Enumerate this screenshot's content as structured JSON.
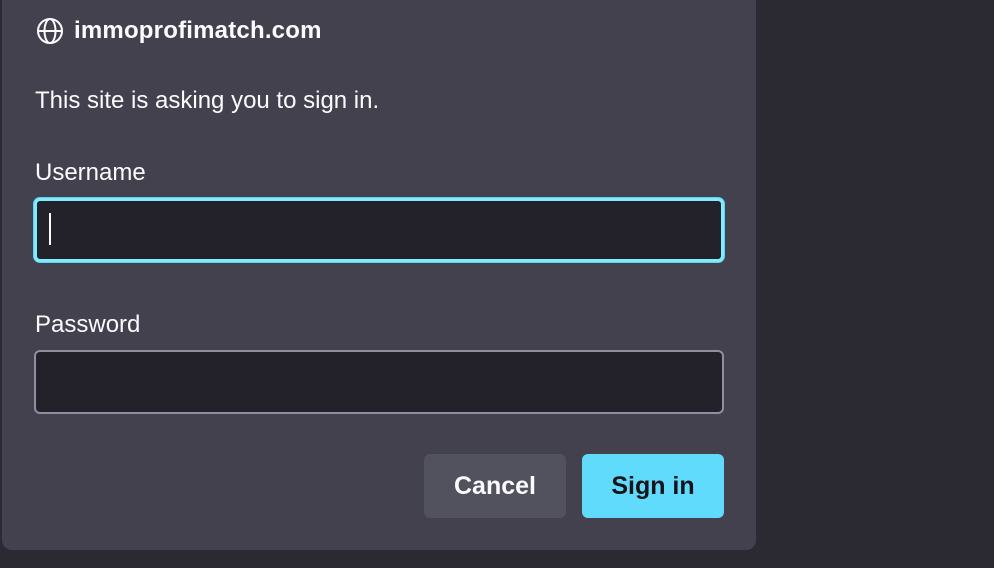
{
  "dialog": {
    "site": "immoprofimatch.com",
    "site_icon": "globe-icon",
    "message": "This site is asking you to sign in.",
    "username_label": "Username",
    "username_value": "",
    "password_label": "Password",
    "password_value": "",
    "cancel_label": "Cancel",
    "signin_label": "Sign in"
  },
  "colors": {
    "background": "#2b2a33",
    "dialog": "#42414d",
    "input_bg": "#23222b",
    "accent": "#61dbfb",
    "focus_ring": "#80ebff",
    "cancel_bg": "#52515e",
    "text": "#fbfbfe"
  }
}
